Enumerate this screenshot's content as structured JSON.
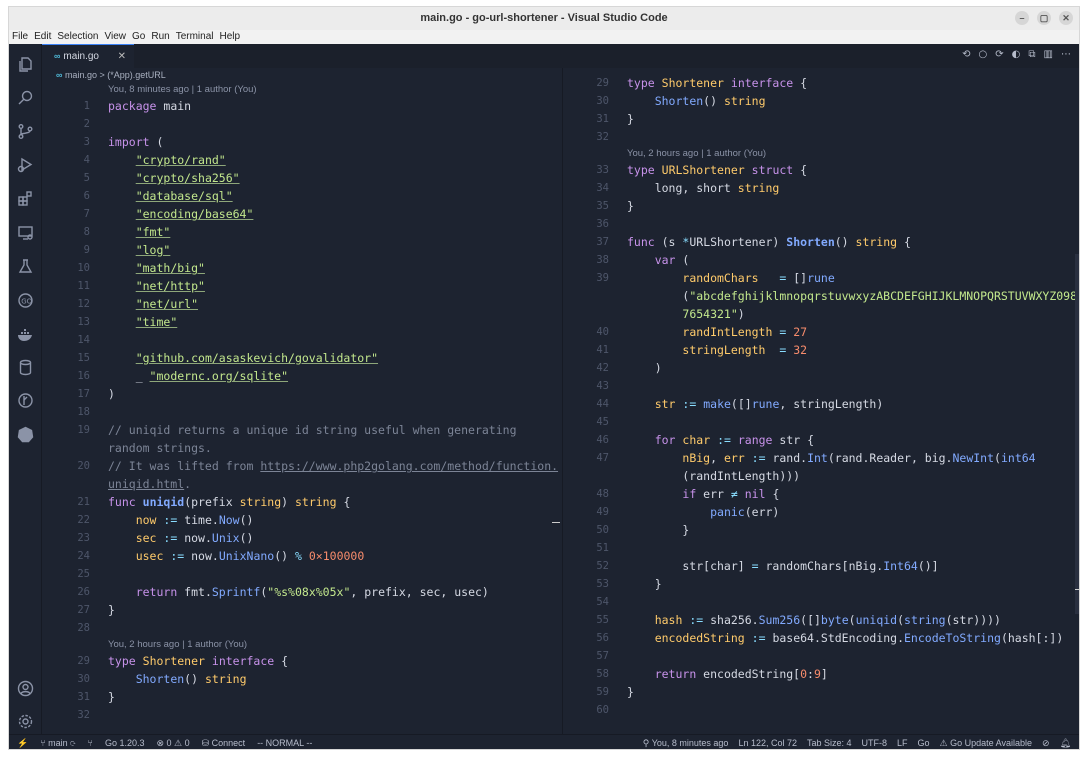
{
  "window": {
    "title": "main.go - go-url-shortener - Visual Studio Code",
    "buttons": [
      "–",
      "▢",
      "✕"
    ]
  },
  "menu": [
    "File",
    "Edit",
    "Selection",
    "View",
    "Go",
    "Run",
    "Terminal",
    "Help"
  ],
  "activity_icons": [
    "files-icon",
    "search-icon",
    "source-control-icon",
    "run-debug-icon",
    "extensions-icon",
    "remote-explorer-icon",
    "testing-icon",
    "go-icon",
    "docker-icon",
    "database-icon",
    "git-graph-icon",
    "kubernetes-icon",
    "account-icon",
    "settings-gear-icon"
  ],
  "tab": {
    "icon": "∞",
    "label": "main.go",
    "close": "✕"
  },
  "breadcrumb": {
    "icon": "∞",
    "file": "main.go",
    "sep": " > ",
    "symbol": "(*App).getURL"
  },
  "blame": {
    "top": "You, 8 minutes ago | 1 author (You)",
    "shortener": "You, 2 hours ago | 1 author (You)"
  },
  "status": {
    "main": "main",
    "go_version": "Go 1.20.3",
    "problems": "⊗ 0 ⚠ 0",
    "connect": "Connect",
    "mode": "-- NORMAL --",
    "blame": "You, 8 minutes ago",
    "position": "Ln 122, Col 72",
    "tab_size": "Tab Size: 4",
    "encoding": "UTF-8",
    "eol": "LF",
    "language": "Go",
    "update": "⚠ Go Update Available"
  },
  "colors": {
    "bg": "#1d2330",
    "keyword": "#c792ea",
    "type": "#ffcb6b",
    "string": "#c3e88d",
    "function": "#82aaff",
    "comment": "#7c8496",
    "number": "#f78c6c"
  }
}
